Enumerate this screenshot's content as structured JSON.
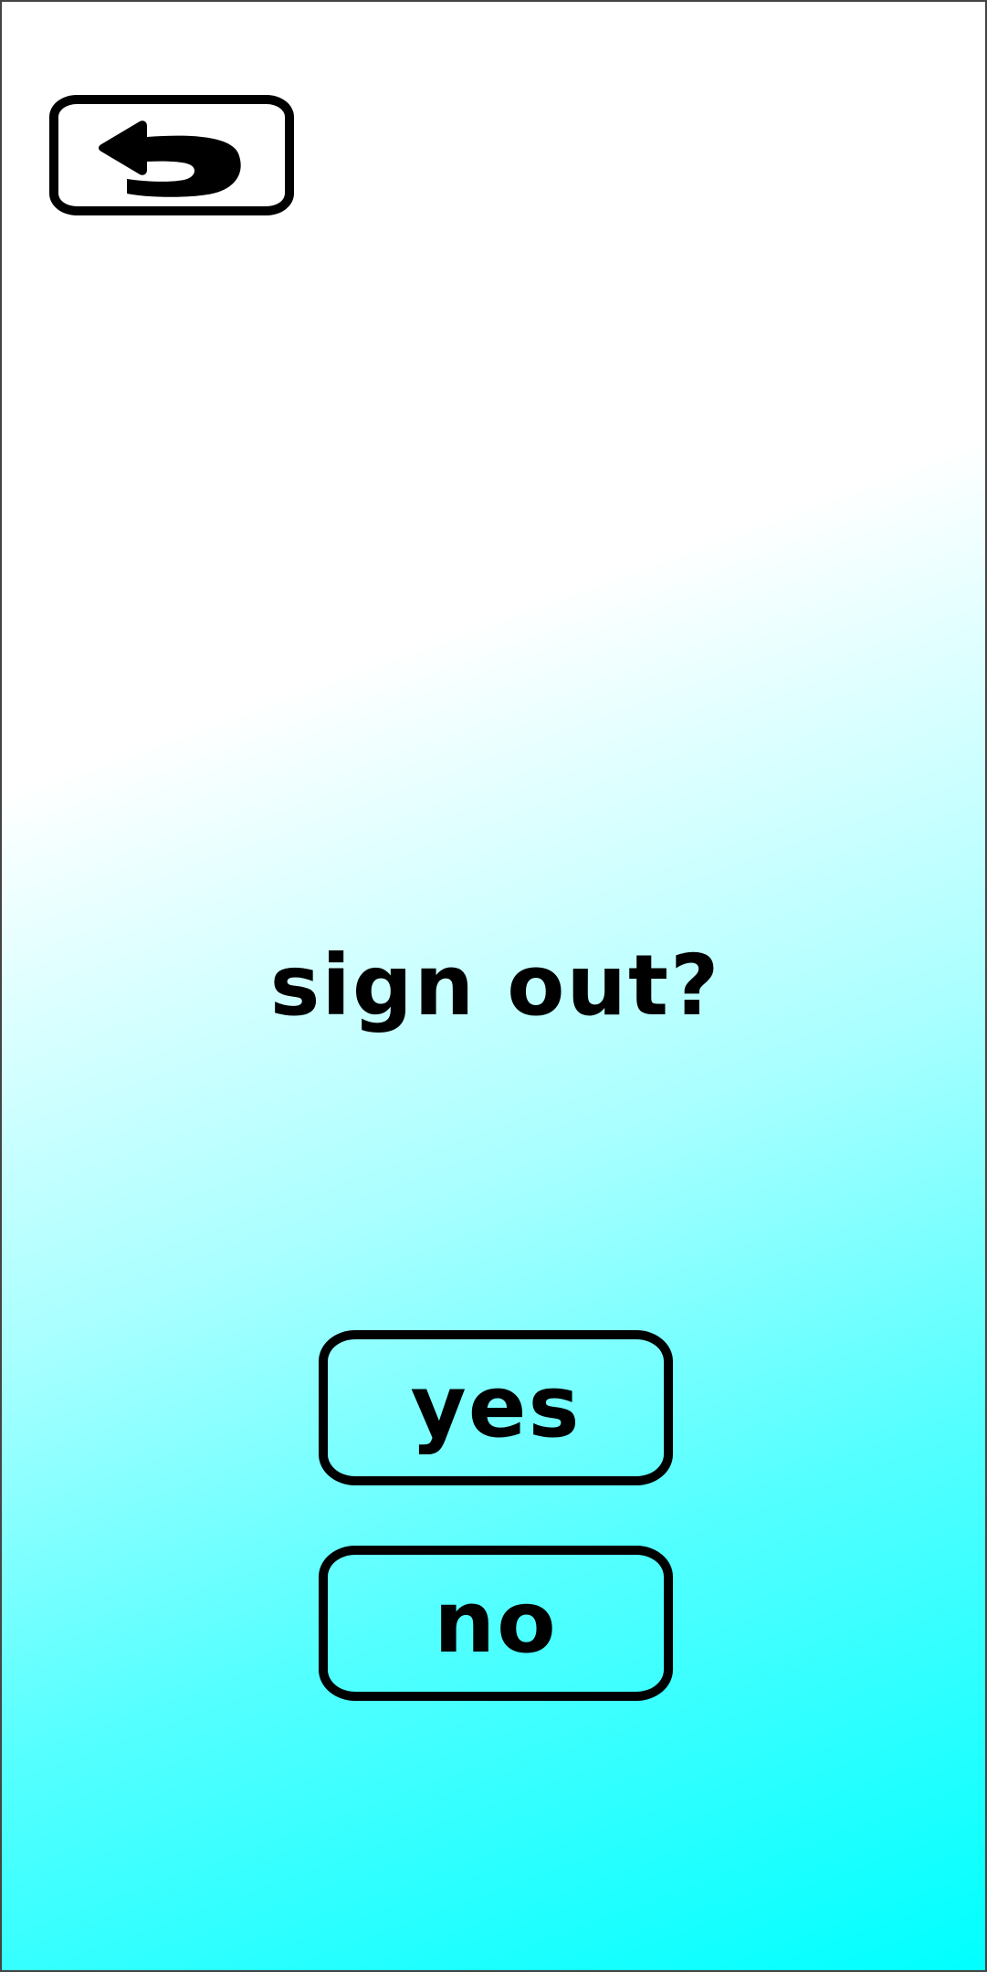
{
  "back_button": {
    "icon": "return-arrow-icon"
  },
  "dialog": {
    "prompt": "sign out?",
    "yes_label": "yes",
    "no_label": "no"
  },
  "colors": {
    "background_top": "#ffffff",
    "background_bottom": "#00ffff",
    "outline": "#000000",
    "text": "#000000"
  }
}
